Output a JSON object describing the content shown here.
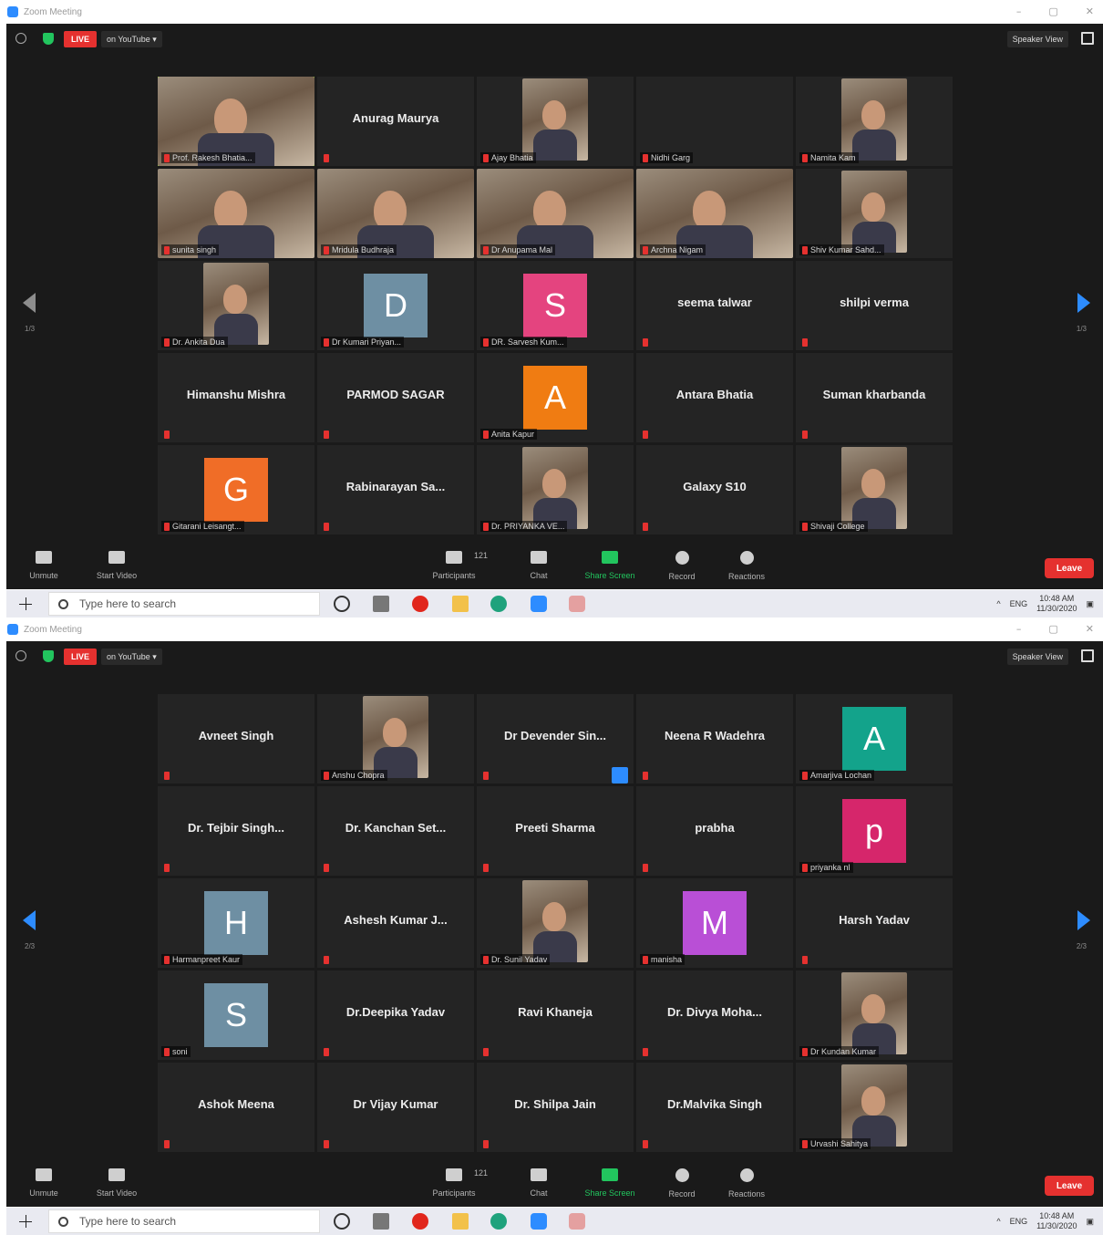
{
  "window": {
    "title": "Zoom Meeting",
    "controls": [
      "–",
      "▢",
      "✕"
    ]
  },
  "topbar": {
    "live": "LIVE",
    "youtube": "on YouTube ▾",
    "speaker_view": "Speaker View"
  },
  "toolbar": {
    "unmute": "Unmute",
    "start_video": "Start Video",
    "participants": "Participants",
    "participants_count": "121",
    "chat": "Chat",
    "share_screen": "Share Screen",
    "record": "Record",
    "reactions": "Reactions",
    "leave": "Leave"
  },
  "taskbar": {
    "search_placeholder": "Type here to search",
    "lang": "ENG",
    "time": "10:48 AM",
    "date": "11/30/2020"
  },
  "pages": [
    {
      "page": "1/3",
      "tiles": [
        {
          "kind": "video",
          "label": "Prof. Rakesh Bhatia...",
          "active": true
        },
        {
          "kind": "name",
          "name": "Anurag Maurya",
          "label": ""
        },
        {
          "kind": "photo",
          "label": "Ajay Bhatia"
        },
        {
          "kind": "name",
          "name": "",
          "label": "Nidhi Garg"
        },
        {
          "kind": "photo",
          "label": "Namita Kam"
        },
        {
          "kind": "video",
          "label": "sunita singh"
        },
        {
          "kind": "video",
          "label": "Mridula Budhraja"
        },
        {
          "kind": "video",
          "label": "Dr Anupama Mal"
        },
        {
          "kind": "video",
          "label": "Archna Nigam"
        },
        {
          "kind": "photo",
          "label": "Shiv Kumar Sahd..."
        },
        {
          "kind": "photo",
          "label": "Dr. Ankita Dua"
        },
        {
          "kind": "letter",
          "letter": "D",
          "color": "#6e8fa3",
          "label": "Dr Kumari Priyan..."
        },
        {
          "kind": "letter",
          "letter": "S",
          "color": "#e4447f",
          "label": "DR. Sarvesh Kum..."
        },
        {
          "kind": "name",
          "name": "seema talwar",
          "label": ""
        },
        {
          "kind": "name",
          "name": "shilpi verma",
          "label": ""
        },
        {
          "kind": "name",
          "name": "Himanshu Mishra",
          "label": ""
        },
        {
          "kind": "name",
          "name": "PARMOD SAGAR",
          "label": ""
        },
        {
          "kind": "letter",
          "letter": "A",
          "color": "#f07c12",
          "label": "Anita Kapur"
        },
        {
          "kind": "name",
          "name": "Antara Bhatia",
          "label": ""
        },
        {
          "kind": "name",
          "name": "Suman kharbanda",
          "label": ""
        },
        {
          "kind": "letter",
          "letter": "G",
          "color": "#f06d27",
          "label": "Gitarani Leisangt..."
        },
        {
          "kind": "name",
          "name": "Rabinarayan Sa...",
          "label": ""
        },
        {
          "kind": "photo",
          "label": "Dr. PRIYANKA VE..."
        },
        {
          "kind": "name",
          "name": "Galaxy S10",
          "label": ""
        },
        {
          "kind": "photo",
          "label": "Shivaji College"
        }
      ]
    },
    {
      "page": "2/3",
      "tiles": [
        {
          "kind": "name",
          "name": "Avneet Singh",
          "label": ""
        },
        {
          "kind": "photo",
          "label": "Anshu Chopra"
        },
        {
          "kind": "name",
          "name": "Dr Devender Sin...",
          "label": ""
        },
        {
          "kind": "name",
          "name": "Neena R Wadehra",
          "label": ""
        },
        {
          "kind": "letter",
          "letter": "A",
          "color": "#13a38b",
          "label": "Amarjiva Lochan"
        },
        {
          "kind": "name",
          "name": "Dr. Tejbir Singh...",
          "label": ""
        },
        {
          "kind": "name",
          "name": "Dr. Kanchan Set...",
          "label": ""
        },
        {
          "kind": "name",
          "name": "Preeti Sharma",
          "label": ""
        },
        {
          "kind": "name",
          "name": "prabha",
          "label": ""
        },
        {
          "kind": "letter",
          "letter": "p",
          "color": "#d6266b",
          "label": "priyanka nl"
        },
        {
          "kind": "letter",
          "letter": "H",
          "color": "#6e8fa3",
          "label": "Harmanpreet Kaur"
        },
        {
          "kind": "name",
          "name": "Ashesh Kumar J...",
          "label": ""
        },
        {
          "kind": "photo",
          "label": "Dr. Sunil Yadav"
        },
        {
          "kind": "letter",
          "letter": "M",
          "color": "#b94fd6",
          "label": "manisha"
        },
        {
          "kind": "name",
          "name": "Harsh Yadav",
          "label": ""
        },
        {
          "kind": "letter",
          "letter": "S",
          "color": "#6e8fa3",
          "label": "soni"
        },
        {
          "kind": "name",
          "name": "Dr.Deepika Yadav",
          "label": ""
        },
        {
          "kind": "name",
          "name": "Ravi Khaneja",
          "label": ""
        },
        {
          "kind": "name",
          "name": "Dr. Divya Moha...",
          "label": ""
        },
        {
          "kind": "photo",
          "label": "Dr Kundan Kumar"
        },
        {
          "kind": "name",
          "name": "Ashok Meena",
          "label": ""
        },
        {
          "kind": "name",
          "name": "Dr Vijay Kumar",
          "label": ""
        },
        {
          "kind": "name",
          "name": "Dr. Shilpa Jain",
          "label": ""
        },
        {
          "kind": "name",
          "name": "Dr.Malvika Singh",
          "label": ""
        },
        {
          "kind": "photo",
          "label": "Urvashi Sahitya"
        }
      ]
    }
  ]
}
